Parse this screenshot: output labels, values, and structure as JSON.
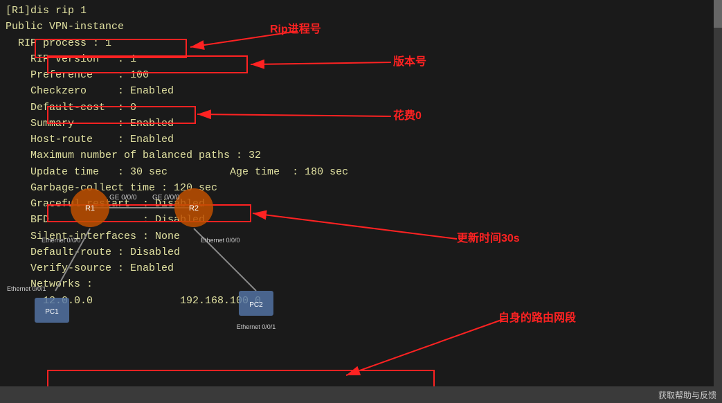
{
  "terminal": {
    "lines": [
      "[R1]dis rip 1",
      "Public VPN-instance",
      "  RIP process : 1",
      "    RIP version   : 1",
      "    Preference    : 100",
      "    Checkzero     : Enabled",
      "    Default-cost  : 0",
      "    Summary       : Enabled",
      "    Host-route    : Enabled",
      "    Maximum number of balanced paths : 32",
      "    Update time   : 30 sec          Age time  : 180 sec",
      "    Garbage-collect time : 120 sec",
      "    Graceful restart  : Disabled",
      "    BFD               : Disabled",
      "    Silent-interfaces : None",
      "    Default-route : Disabled",
      "    Verify-source : Enabled",
      "    Networks :",
      "      12.0.0.0              192.168.100.0"
    ]
  },
  "annotations": {
    "rip_process": "Rip进程号",
    "version": "版本号",
    "cost": "花费0",
    "update_time": "更新时间30s",
    "networks": "自身的路由网段"
  },
  "network": {
    "r1_label": "R1",
    "r2_label": "R2",
    "ge_label1": "GE 0/0/0",
    "ge_label2": "GE 0/0/0",
    "ethernet1": "Ethernet 0/0/0",
    "ethernet2": "Ethernet 0/0/0",
    "ethernet3": "Ethernet 0/0/1",
    "pc1_label": "PC1",
    "pc2_label": "PC2",
    "ethernet4": "Ethernet 0/0/1"
  },
  "status_bar": {
    "text": "获取帮助与反馈"
  }
}
